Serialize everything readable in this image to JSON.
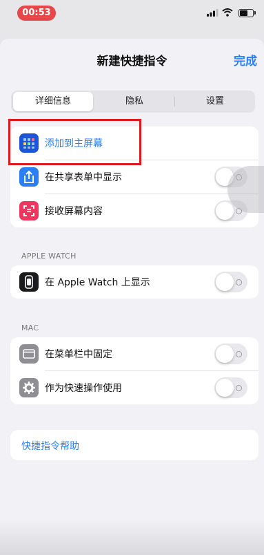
{
  "status_bar": {
    "time": "00:53"
  },
  "nav": {
    "title": "新建快捷指令",
    "done_label": "完成"
  },
  "segments": {
    "details": "详细信息",
    "privacy": "隐私",
    "settings": "设置"
  },
  "details_section": {
    "add_to_home": "添加到主屏幕",
    "show_in_share_sheet": "在共享表单中显示",
    "receive_screen": "接收屏幕内容"
  },
  "watch_section": {
    "header": "APPLE WATCH",
    "show_on_watch": "在 Apple Watch 上显示"
  },
  "mac_section": {
    "header": "MAC",
    "pin_menu_bar": "在菜单栏中固定",
    "quick_action": "作为快速操作使用"
  },
  "help": {
    "label": "快捷指令帮助"
  },
  "colors": {
    "accent": "#2b7ff6",
    "highlight": "#e0191f",
    "status_pill": "#e8474a"
  }
}
